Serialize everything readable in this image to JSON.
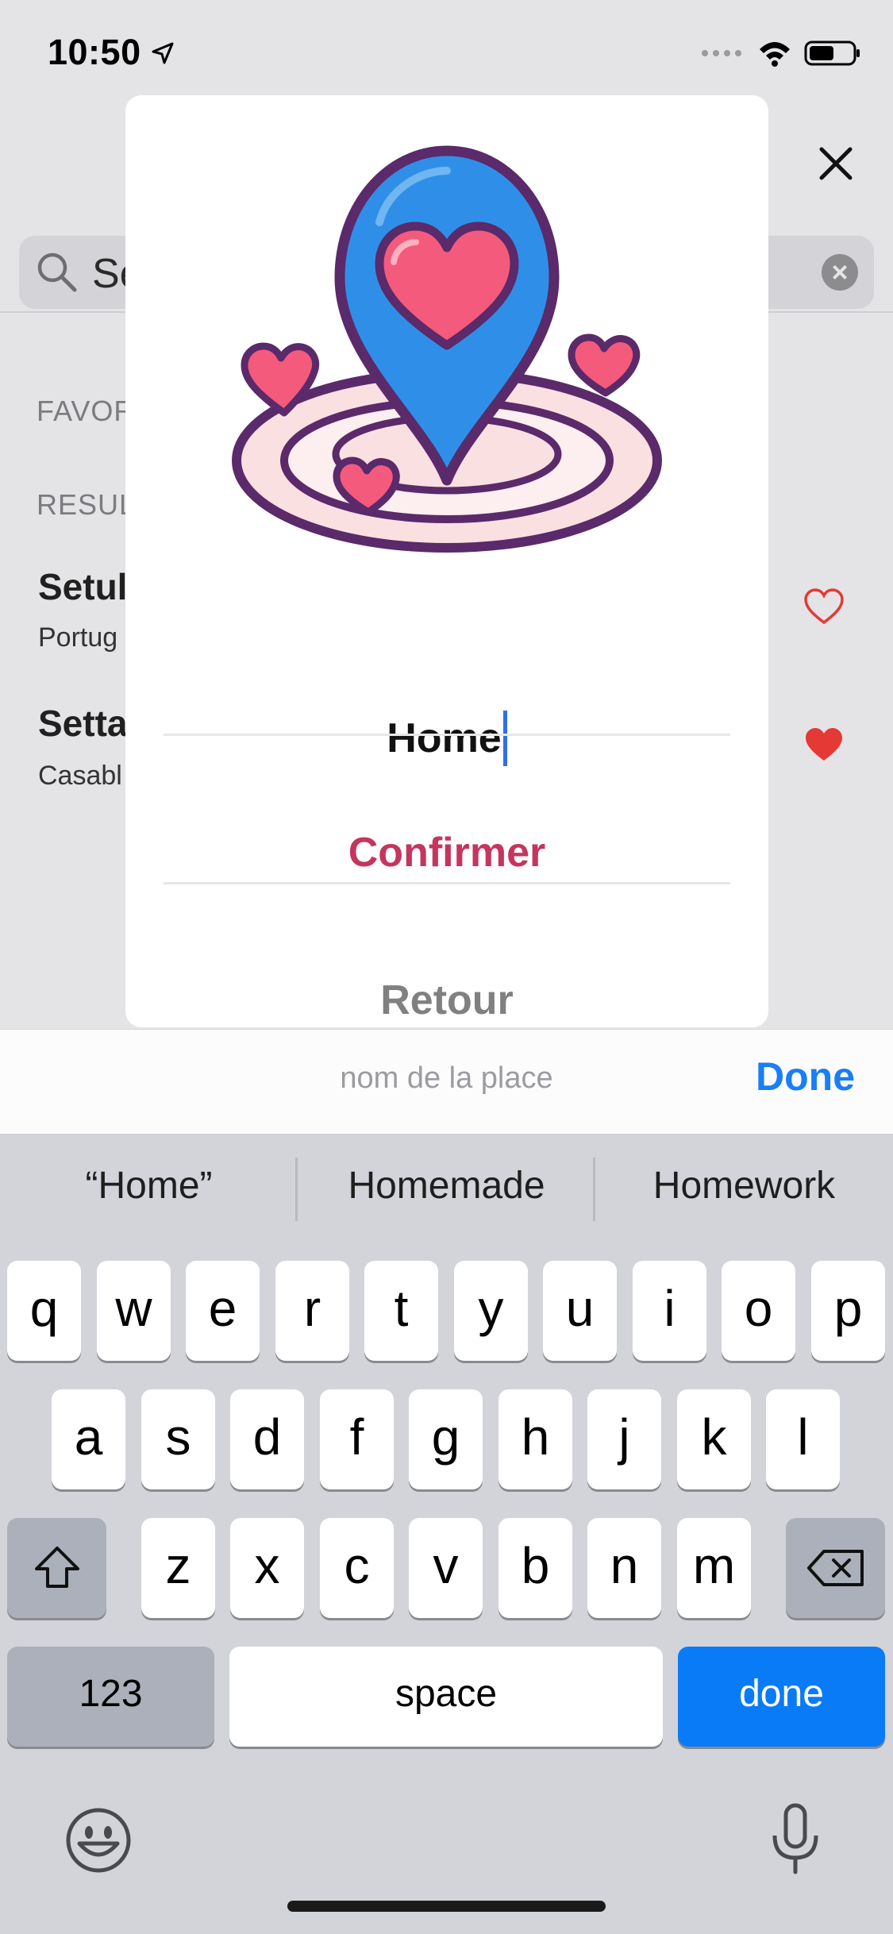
{
  "status_bar": {
    "time": "10:50"
  },
  "search": {
    "value": "Se"
  },
  "sections": {
    "favorites_label": "FAVOR",
    "results_label": "RESUL"
  },
  "results": [
    {
      "title": "Setul",
      "subtitle": "Portug",
      "favorite": false
    },
    {
      "title": "Setta",
      "subtitle": "Casabl",
      "favorite": true
    }
  ],
  "modal": {
    "input_value": "Home",
    "confirm_label": "Confirmer",
    "back_label": "Retour"
  },
  "toolbar": {
    "placeholder": "nom de la place",
    "done_label": "Done"
  },
  "keyboard": {
    "suggestions": [
      "“Home”",
      "Homemade",
      "Homework"
    ],
    "row1": [
      "q",
      "w",
      "e",
      "r",
      "t",
      "y",
      "u",
      "i",
      "o",
      "p"
    ],
    "row2": [
      "a",
      "s",
      "d",
      "f",
      "g",
      "h",
      "j",
      "k",
      "l"
    ],
    "row3": [
      "z",
      "x",
      "c",
      "v",
      "b",
      "n",
      "m"
    ],
    "numbers_label": "123",
    "space_label": "space",
    "return_label": "done"
  },
  "colors": {
    "accent_confirm": "#c4365e",
    "accent_done": "#1a7ef5",
    "heart": "#e53935"
  }
}
